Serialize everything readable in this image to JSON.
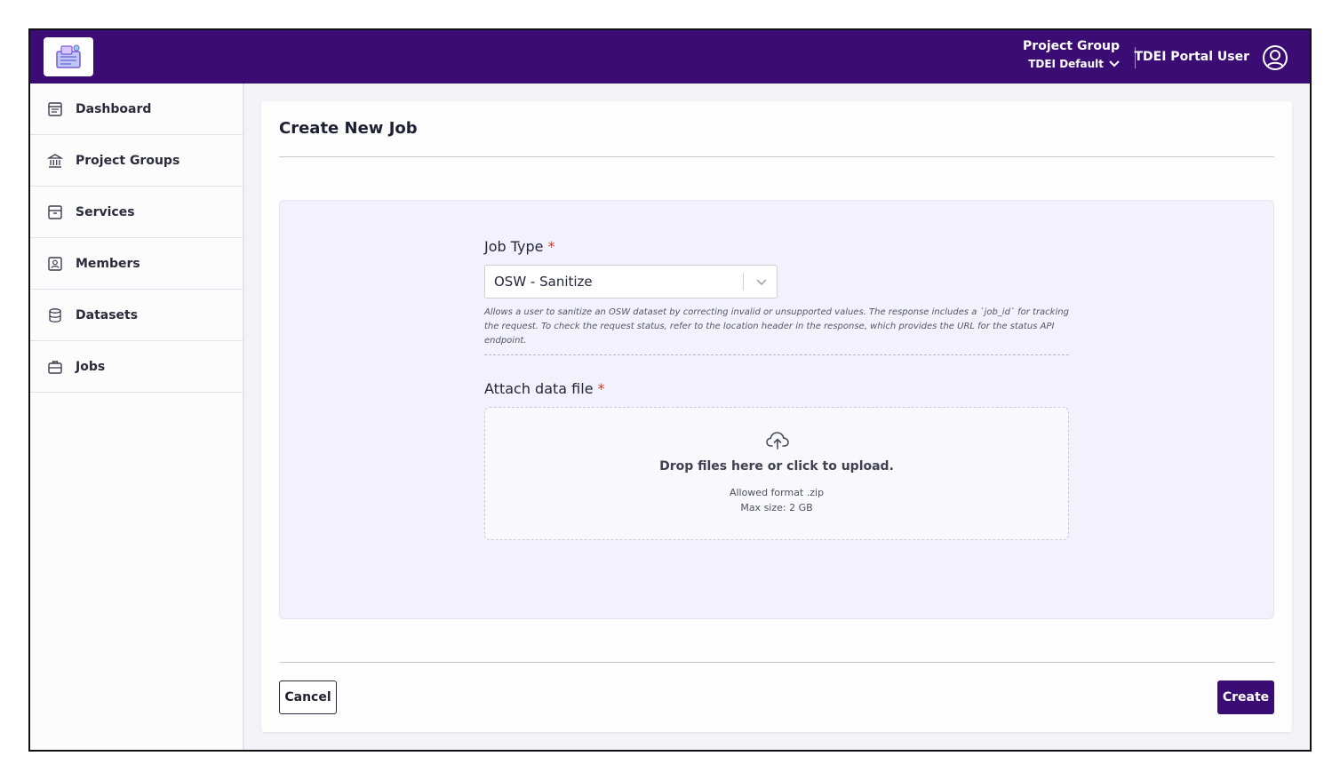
{
  "header": {
    "project_group_label": "Project Group",
    "project_group_value": "TDEI Default",
    "user_name": "TDEI Portal User",
    "accent_color": "#3b0c74"
  },
  "sidebar": {
    "items": [
      {
        "label": "Dashboard",
        "icon": "dashboard-icon"
      },
      {
        "label": "Project Groups",
        "icon": "bank-icon"
      },
      {
        "label": "Services",
        "icon": "archive-icon"
      },
      {
        "label": "Members",
        "icon": "member-badge-icon"
      },
      {
        "label": "Datasets",
        "icon": "database-icon"
      },
      {
        "label": "Jobs",
        "icon": "briefcase-icon"
      }
    ]
  },
  "main": {
    "title": "Create New Job",
    "job_type": {
      "label": "Job Type",
      "required_mark": "*",
      "selected": "OSW - Sanitize",
      "help": "Allows a user to sanitize an OSW dataset by correcting invalid or unsupported values. The response includes a `job_id` for tracking the request. To check the request status, refer to the location header in the response, which provides the URL for the status API endpoint."
    },
    "attach": {
      "label": "Attach data file",
      "required_mark": "*",
      "drop_text": "Drop files here or click to upload.",
      "format_text": "Allowed format .zip",
      "size_text": "Max size: 2 GB"
    },
    "cancel_label": "Cancel",
    "create_label": "Create"
  }
}
